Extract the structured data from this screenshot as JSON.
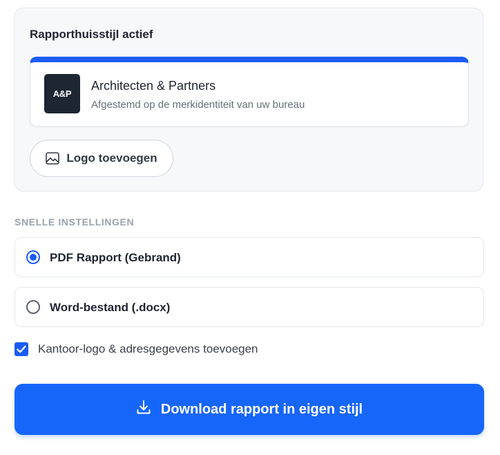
{
  "style_card": {
    "title": "Rapporthuisstijl actief",
    "brand": {
      "logo_text": "A&P",
      "name": "Architecten & Partners",
      "subtitle": "Afgestemd op de merkidentiteit van uw bureau",
      "accent_color": "#1a5cf5"
    },
    "add_logo_label": "Logo toevoegen",
    "add_logo_icon": "image-icon"
  },
  "quick_settings": {
    "label": "SNELLE INSTELLINGEN",
    "options": [
      {
        "label": "PDF Rapport (Gebrand)",
        "selected": true
      },
      {
        "label": "Word-bestand (.docx)",
        "selected": false
      }
    ],
    "checkbox": {
      "label": "Kantoor-logo & adresgegevens toevoegen",
      "checked": true
    }
  },
  "download": {
    "label": "Download rapport in eigen stijl",
    "icon": "download-icon",
    "color": "#1766fa"
  }
}
